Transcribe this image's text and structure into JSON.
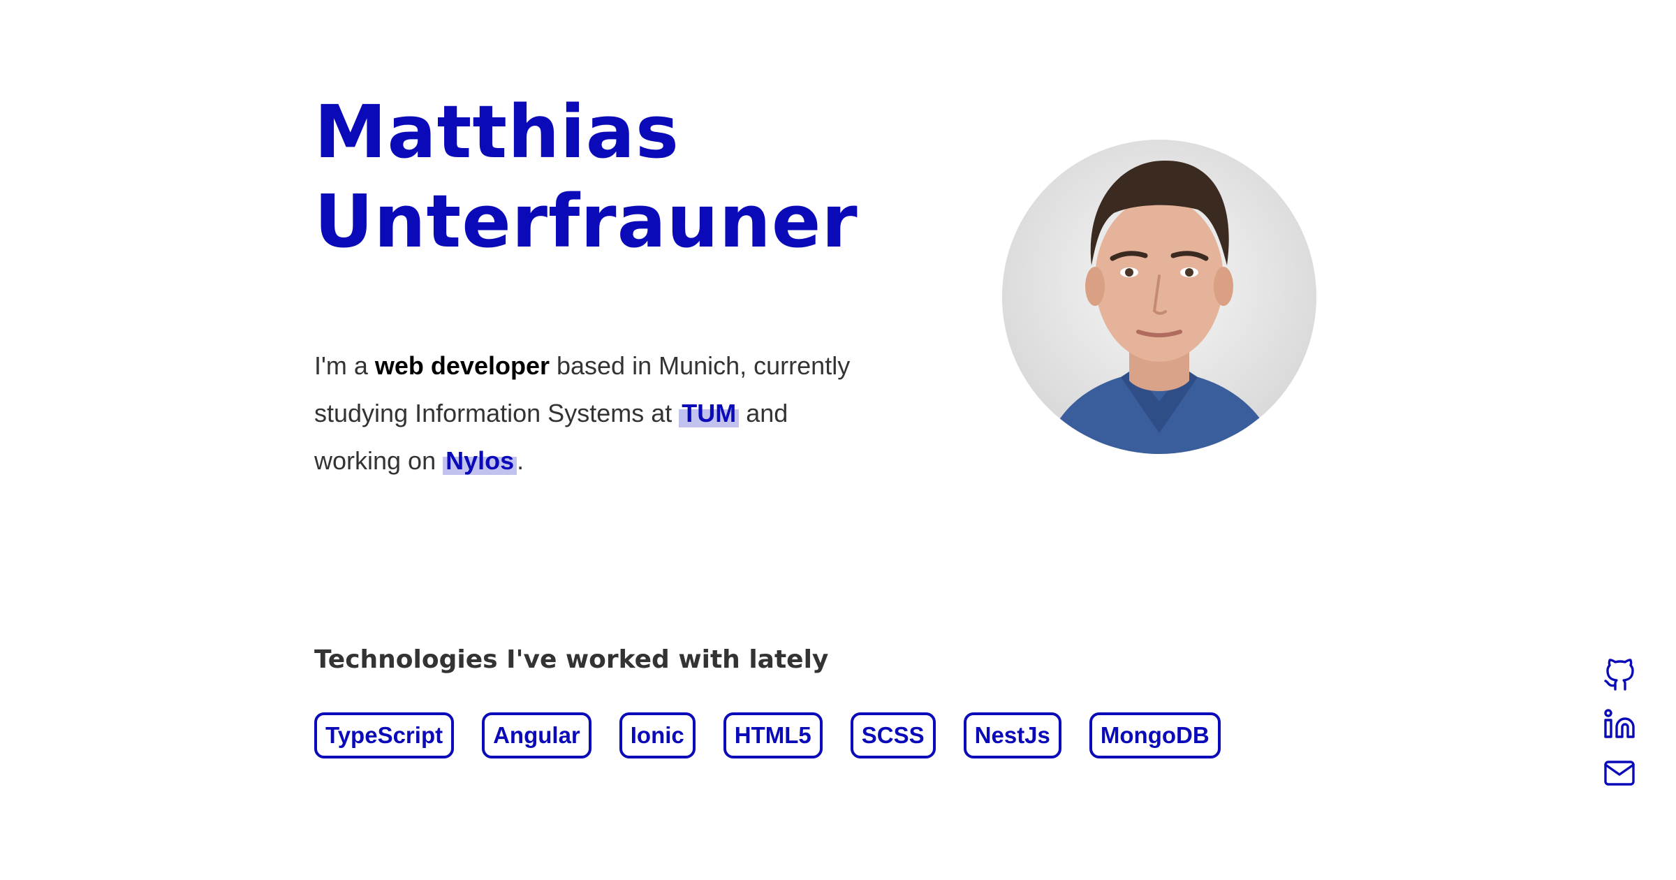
{
  "hero": {
    "name_line1": "Matthias",
    "name_line2": "Unterfrauner",
    "intro": {
      "p1": "I'm a ",
      "role": "web developer",
      "p2": " based in Munich, currently studying Information Systems at ",
      "school": "TUM",
      "p3": " and working on ",
      "project": "Nylos",
      "p4": "."
    }
  },
  "technologies": {
    "heading": "Technologies I've worked with lately",
    "tags": [
      "TypeScript",
      "Angular",
      "Ionic",
      "HTML5",
      "SCSS",
      "NestJs",
      "MongoDB"
    ]
  },
  "social": {
    "icons": [
      "github-icon",
      "linkedin-icon",
      "mail-icon"
    ]
  },
  "colors": {
    "accent": "#0a0ab9",
    "text": "#333333",
    "highlight": "rgba(10,10,185,0.25)"
  }
}
